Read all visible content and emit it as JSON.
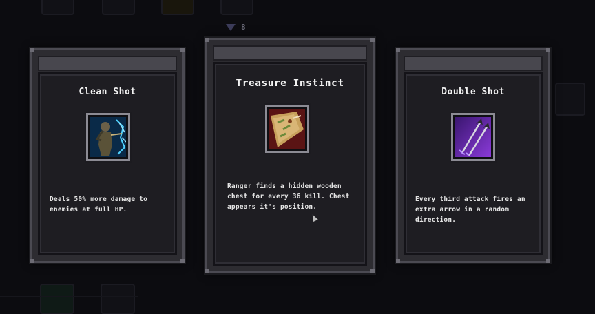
{
  "header": {
    "gem_count": "8",
    "gem_icon": "gem-icon"
  },
  "cards": [
    {
      "title": "Clean Shot",
      "icon": "archer-icon",
      "description": "Deals 50% more damage to enemies at full HP."
    },
    {
      "title": "Treasure Instinct",
      "icon": "treasure-map-icon",
      "description": "Ranger finds a hidden wooden chest for every 36 kill. Chest appears it's position."
    },
    {
      "title": "Double Shot",
      "icon": "double-arrow-icon",
      "description": "Every third attack fires an extra arrow in a random direction."
    }
  ],
  "colors": {
    "background": "#0c0c10",
    "card": "#2d2c31",
    "panel": "#1e1d22",
    "text": "#f2f2f2"
  }
}
